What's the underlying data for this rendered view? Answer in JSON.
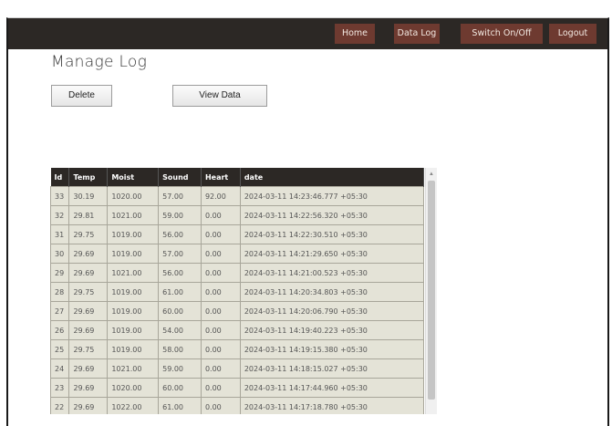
{
  "nav": {
    "home": "Home",
    "data_log": "Data Log",
    "switch": "Switch On/Off",
    "logout": "Logout"
  },
  "page": {
    "title": "Manage Log",
    "delete_label": "Delete",
    "view_label": "View Data"
  },
  "table": {
    "headers": [
      "Id",
      "Temp",
      "Moist",
      "Sound",
      "Heart",
      "date"
    ],
    "rows": [
      [
        "33",
        "30.19",
        "1020.00",
        "57.00",
        "92.00",
        "2024-03-11 14:23:46.777 +05:30"
      ],
      [
        "32",
        "29.81",
        "1021.00",
        "59.00",
        "0.00",
        "2024-03-11 14:22:56.320 +05:30"
      ],
      [
        "31",
        "29.75",
        "1019.00",
        "56.00",
        "0.00",
        "2024-03-11 14:22:30.510 +05:30"
      ],
      [
        "30",
        "29.69",
        "1019.00",
        "57.00",
        "0.00",
        "2024-03-11 14:21:29.650 +05:30"
      ],
      [
        "29",
        "29.69",
        "1021.00",
        "56.00",
        "0.00",
        "2024-03-11 14:21:00.523 +05:30"
      ],
      [
        "28",
        "29.75",
        "1019.00",
        "61.00",
        "0.00",
        "2024-03-11 14:20:34.803 +05:30"
      ],
      [
        "27",
        "29.69",
        "1019.00",
        "60.00",
        "0.00",
        "2024-03-11 14:20:06.790 +05:30"
      ],
      [
        "26",
        "29.69",
        "1019.00",
        "54.00",
        "0.00",
        "2024-03-11 14:19:40.223 +05:30"
      ],
      [
        "25",
        "29.75",
        "1019.00",
        "58.00",
        "0.00",
        "2024-03-11 14:19:15.380 +05:30"
      ],
      [
        "24",
        "29.69",
        "1021.00",
        "59.00",
        "0.00",
        "2024-03-11 14:18:15.027 +05:30"
      ],
      [
        "23",
        "29.69",
        "1020.00",
        "60.00",
        "0.00",
        "2024-03-11 14:17:44.960 +05:30"
      ],
      [
        "22",
        "29.69",
        "1022.00",
        "61.00",
        "0.00",
        "2024-03-11 14:17:18.780 +05:30"
      ]
    ]
  },
  "colors": {
    "navbar": "#2c2825",
    "nav_button": "#6e3a30",
    "row_bg": "#e4e3d7"
  }
}
